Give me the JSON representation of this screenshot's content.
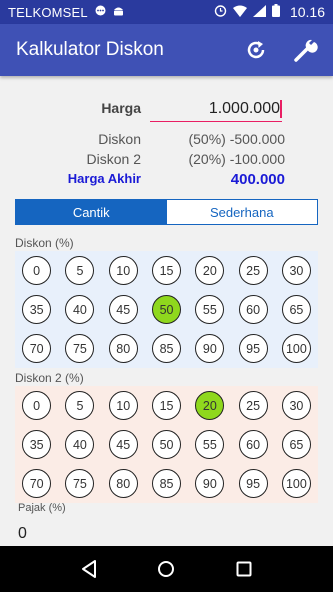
{
  "statusbar": {
    "carrier": "TELKOMSEL",
    "time": "10.16"
  },
  "appbar": {
    "title": "Kalkulator Diskon",
    "icons": [
      "refresh-icon",
      "wrench-icon"
    ]
  },
  "summary": {
    "harga_label": "Harga",
    "harga_value": "1.000.000",
    "diskon_label": "Diskon",
    "diskon_value": "(50%) -500.000",
    "diskon2_label": "Diskon 2",
    "diskon2_value": "(20%) -100.000",
    "akhir_label": "Harga Akhir",
    "akhir_value": "400.000"
  },
  "tabs": [
    {
      "label": "Cantik",
      "active": true
    },
    {
      "label": "Sederhana",
      "active": false
    }
  ],
  "diskon1": {
    "label": "Diskon (%)",
    "selected": "50",
    "options": [
      "0",
      "5",
      "10",
      "15",
      "20",
      "25",
      "30",
      "35",
      "40",
      "45",
      "50",
      "55",
      "60",
      "65",
      "70",
      "75",
      "80",
      "85",
      "90",
      "95",
      "100"
    ]
  },
  "diskon2": {
    "label": "Diskon 2 (%)",
    "selected": "20",
    "options": [
      "0",
      "5",
      "10",
      "15",
      "20",
      "25",
      "30",
      "35",
      "40",
      "45",
      "50",
      "55",
      "60",
      "65",
      "70",
      "75",
      "80",
      "85",
      "90",
      "95",
      "100"
    ]
  },
  "pajak": {
    "label": "Pajak (%)",
    "value": "0"
  },
  "colors": {
    "appbar": "#3f51b5",
    "statusbar": "#2a3a9e",
    "accent": "#1a1ad6",
    "selected": "#8fd81d",
    "tab": "#1565c0",
    "underline": "#e91e63"
  }
}
